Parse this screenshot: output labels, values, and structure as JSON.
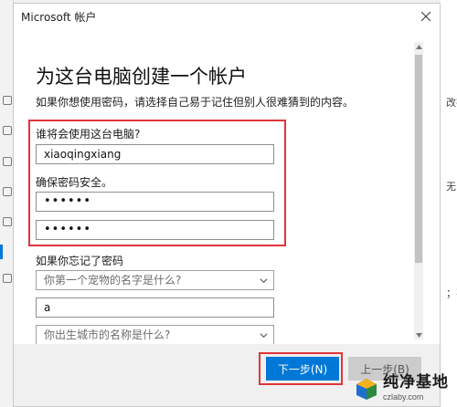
{
  "background": {
    "right_fragments": [
      "改密",
      "无",
      "；不"
    ]
  },
  "dialog": {
    "title": "Microsoft 帐户",
    "heading": "为这台电脑创建一个帐户",
    "description": "如果你想使用密码，请选择自己易于记住但别人很难猜到的内容。",
    "user_label": "谁将会使用这台电脑?",
    "username_value": "xiaoqingxiang",
    "password_label": "确保密码安全。",
    "password_value": "••••••",
    "password_confirm_value": "••••••",
    "forgot_label": "如果你忘记了密码",
    "security_question_1": "你第一个宠物的名字是什么?",
    "security_answer_1": "a",
    "security_question_2": "你出生城市的名称是什么?",
    "next_label": "下一步(N)",
    "back_label": "上一步(B)"
  },
  "watermark": {
    "brand": "纯净基地",
    "url": "czlaby.com"
  },
  "colors": {
    "accent": "#0078d7",
    "highlight": "#e2333b"
  }
}
